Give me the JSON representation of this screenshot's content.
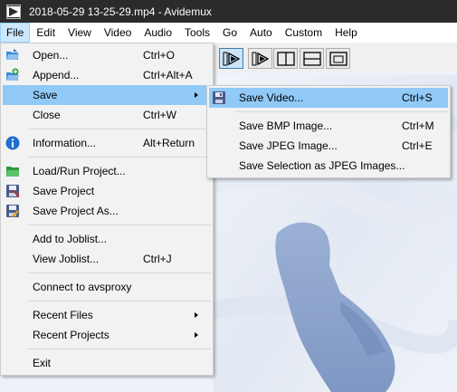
{
  "window": {
    "title": "2018-05-29 13-25-29.mp4 - Avidemux",
    "icon": "avidemux-app-icon"
  },
  "menubar": [
    {
      "label": "File",
      "active": true
    },
    {
      "label": "Edit"
    },
    {
      "label": "View"
    },
    {
      "label": "Video"
    },
    {
      "label": "Audio"
    },
    {
      "label": "Tools"
    },
    {
      "label": "Go"
    },
    {
      "label": "Auto"
    },
    {
      "label": "Custom"
    },
    {
      "label": "Help"
    }
  ],
  "file_menu": {
    "items": [
      {
        "label": "Open...",
        "shortcut": "Ctrl+O",
        "icon": "open-folder-icon"
      },
      {
        "label": "Append...",
        "shortcut": "Ctrl+Alt+A",
        "icon": "append-icon"
      },
      {
        "label": "Save",
        "submenu": true,
        "highlighted": true
      },
      {
        "label": "Close",
        "shortcut": "Ctrl+W"
      },
      {
        "label": "Information...",
        "shortcut": "Alt+Return",
        "icon": "info-icon"
      },
      {
        "label": "Load/Run Project...",
        "icon": "load-project-icon"
      },
      {
        "label": "Save Project",
        "icon": "save-project-icon"
      },
      {
        "label": "Save Project As...",
        "icon": "save-project-as-icon"
      },
      {
        "label": "Add to Joblist..."
      },
      {
        "label": "View Joblist...",
        "shortcut": "Ctrl+J"
      },
      {
        "label": "Connect to avsproxy"
      },
      {
        "label": "Recent Files",
        "submenu": true
      },
      {
        "label": "Recent Projects",
        "submenu": true
      },
      {
        "label": "Exit"
      }
    ]
  },
  "save_menu": {
    "items": [
      {
        "label": "Save Video...",
        "shortcut": "Ctrl+S",
        "highlighted": true,
        "icon": "floppy-icon"
      },
      {
        "label": "Save BMP Image...",
        "shortcut": "Ctrl+M"
      },
      {
        "label": "Save JPEG Image...",
        "shortcut": "Ctrl+E"
      },
      {
        "label": "Save Selection as JPEG Images..."
      }
    ]
  },
  "toolbar": {
    "buttons": [
      "play-forward-icon",
      "next-frame-icon",
      "split-view-icon",
      "horizontal-split-icon",
      "single-view-icon"
    ]
  },
  "colors": {
    "titlebar": "#2b2b2b",
    "menu_highlight": "#91c9f7",
    "menubar_active": "#cce8ff",
    "menu_bg": "#f2f2f2"
  }
}
